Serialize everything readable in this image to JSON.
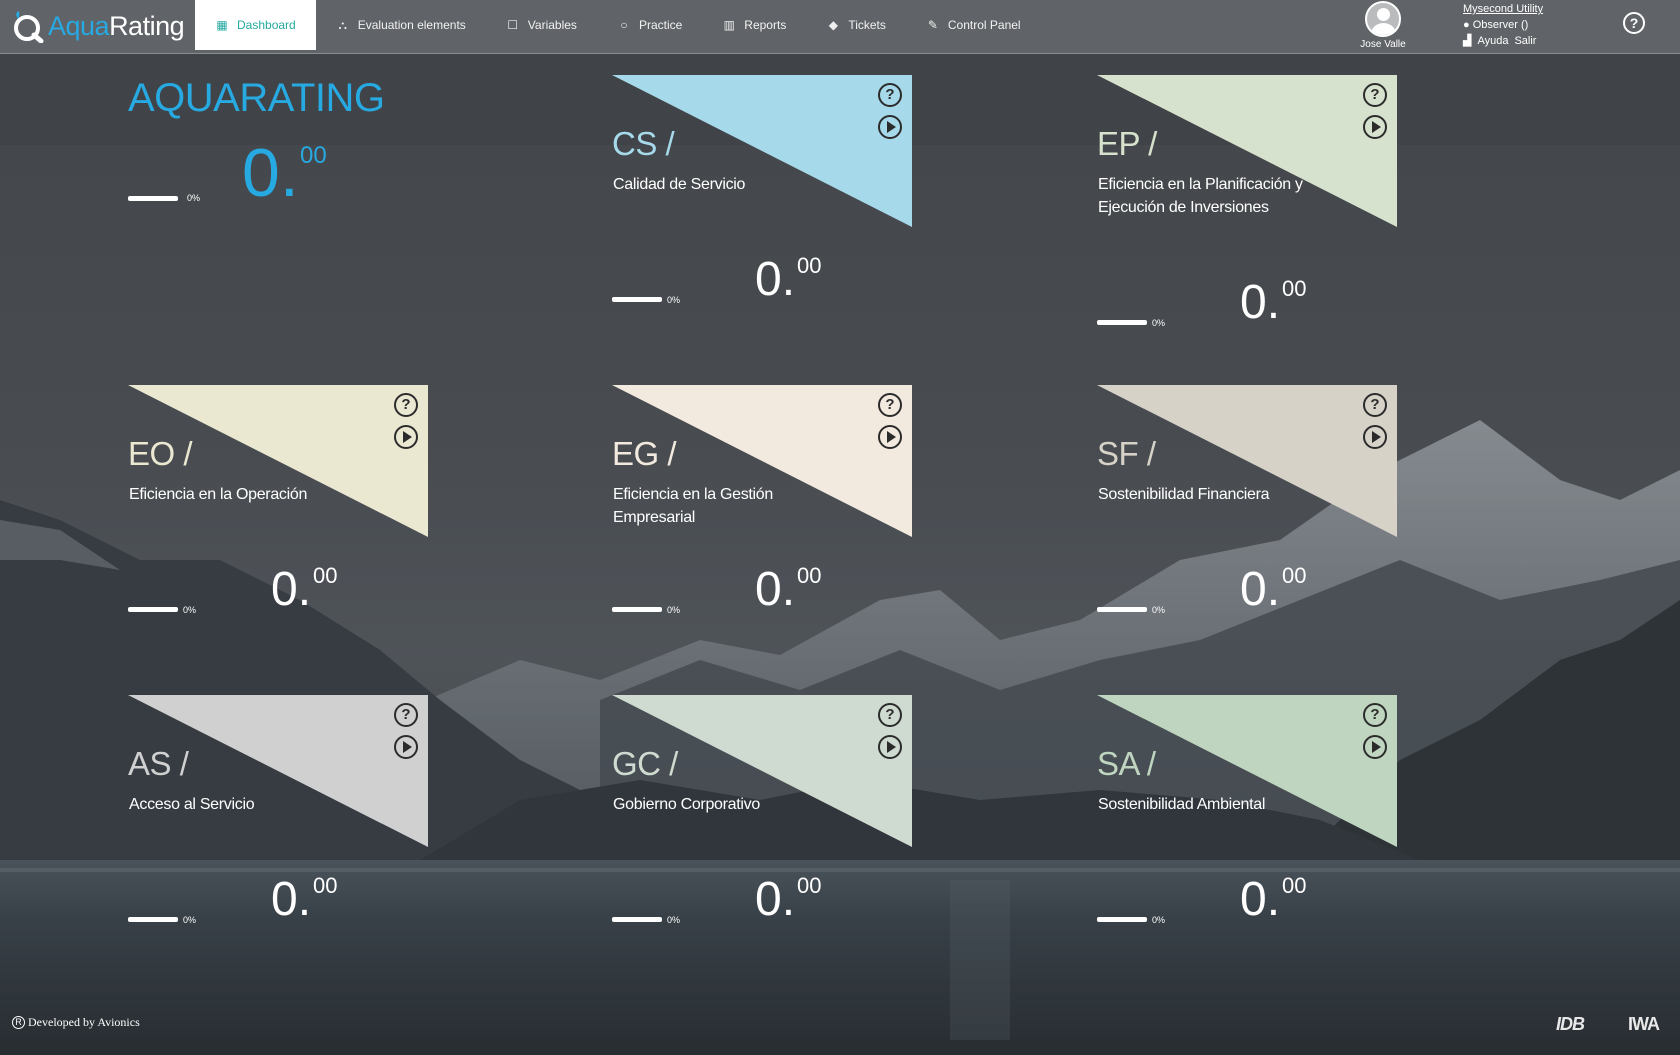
{
  "app": {
    "logo_aqua": "Aqua",
    "logo_rating": "Rating"
  },
  "nav": [
    {
      "label": "Dashboard",
      "icon": "▦",
      "icon_name": "grid-icon",
      "active": true
    },
    {
      "label": "Evaluation elements",
      "icon": "⛬",
      "icon_name": "sitemap-icon",
      "active": false
    },
    {
      "label": "Variables",
      "icon": "☐",
      "icon_name": "square-icon",
      "active": false
    },
    {
      "label": "Practice",
      "icon": "○",
      "icon_name": "circle-icon",
      "active": false
    },
    {
      "label": "Reports",
      "icon": "▥",
      "icon_name": "bar-chart-icon",
      "active": false
    },
    {
      "label": "Tickets",
      "icon": "◆",
      "icon_name": "tag-icon",
      "active": false
    },
    {
      "label": "Control Panel",
      "icon": "✎",
      "icon_name": "wrench-icon",
      "active": false
    }
  ],
  "user": {
    "name": "Jose Valle"
  },
  "utility": {
    "name": "Mysecond Utility",
    "role": "● Observer ()",
    "help": "Ayuda",
    "logout": "Salir"
  },
  "main": {
    "title": "AQUARATING",
    "score_int": "0.",
    "score_dec": "00",
    "progress_pct": "0%",
    "progress_value": 0
  },
  "cards": [
    {
      "code": "CS /",
      "name": "Calidad de Servicio",
      "score_int": "0.",
      "score_dec": "00",
      "progress_pct": "0%",
      "progress_value": 0,
      "color": "#a6d9e9",
      "code_color": "#a6d9e9"
    },
    {
      "code": "EP /",
      "name": "Eficiencia en la Planificación y Ejecución de Inversiones",
      "score_int": "0.",
      "score_dec": "00",
      "progress_pct": "0%",
      "progress_value": 0,
      "color": "#d6e2cd",
      "code_color": "#d6e2cd"
    },
    {
      "code": "EO /",
      "name": "Eficiencia en la Operación",
      "score_int": "0.",
      "score_dec": "00",
      "progress_pct": "0%",
      "progress_value": 0,
      "color": "#ebe8d2",
      "code_color": "#ebe8d2"
    },
    {
      "code": "EG /",
      "name": "Eficiencia en la Gestión Empresarial",
      "score_int": "0.",
      "score_dec": "00",
      "progress_pct": "0%",
      "progress_value": 0,
      "color": "#f3eadf",
      "code_color": "#f3eadf"
    },
    {
      "code": "SF /",
      "name": "Sostenibilidad Financiera",
      "score_int": "0.",
      "score_dec": "00",
      "progress_pct": "0%",
      "progress_value": 0,
      "color": "#d6d2c8",
      "code_color": "#d6d2c8"
    },
    {
      "code": "AS /",
      "name": "Acceso al Servicio",
      "score_int": "0.",
      "score_dec": "00",
      "progress_pct": "0%",
      "progress_value": 0,
      "color": "#d0d0d0",
      "code_color": "#d0d0d0"
    },
    {
      "code": "GC /",
      "name": "Gobierno Corporativo",
      "score_int": "0.",
      "score_dec": "00",
      "progress_pct": "0%",
      "progress_value": 0,
      "color": "#cfdbd0",
      "code_color": "#cfdbd0"
    },
    {
      "code": "SA /",
      "name": "Sostenibilidad Ambiental",
      "score_int": "0.",
      "score_dec": "00",
      "progress_pct": "0%",
      "progress_value": 0,
      "color": "#bfd5bf",
      "code_color": "#bfd5bf"
    }
  ],
  "footer": {
    "developed": "Developed by Avionics",
    "reg_symbol": "R",
    "logo_idb": "IDB",
    "logo_iwa": "IWA"
  },
  "colors": {
    "accent": "#27a9e1",
    "nav_active_text": "#27a9a1"
  }
}
